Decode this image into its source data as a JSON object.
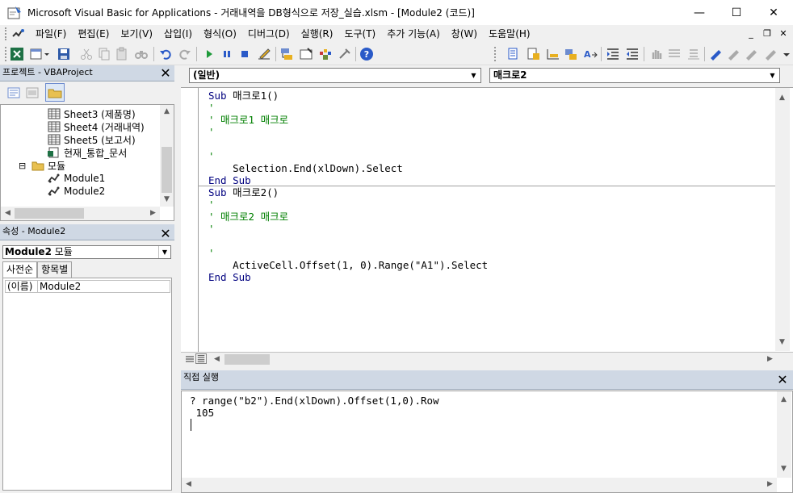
{
  "window": {
    "title": "Microsoft Visual Basic for Applications - 거래내역을 DB형식으로 저장_실습.xlsm - [Module2 (코드)]",
    "minimize": "—",
    "maximize": "☐",
    "close": "✕"
  },
  "menu": {
    "items": [
      "파일(F)",
      "편집(E)",
      "보기(V)",
      "삽입(I)",
      "형식(O)",
      "디버그(D)",
      "실행(R)",
      "도구(T)",
      "추가 기능(A)",
      "창(W)",
      "도움말(H)"
    ],
    "mdi_minimize": "_",
    "mdi_restore": "❐",
    "mdi_close": "✕"
  },
  "toolbar": {
    "icons": [
      "excel-view-icon",
      "insert-module-icon",
      "save-icon",
      "cut-icon",
      "copy-icon",
      "paste-icon",
      "find-icon",
      "undo-icon",
      "redo-icon",
      "run-icon",
      "break-icon",
      "reset-icon",
      "design-mode-icon",
      "project-explorer-icon",
      "properties-icon",
      "object-browser-icon",
      "toolbox-icon",
      "help-icon"
    ],
    "edit_icons": [
      "list-properties-icon",
      "list-constants-icon",
      "quick-info-icon",
      "parameter-info-icon",
      "complete-word-icon",
      "indent-icon",
      "outdent-icon",
      "toggle-breakpoint-icon",
      "comment-block-icon",
      "uncomment-block-icon",
      "toggle-bookmark-icon",
      "next-bookmark-icon",
      "previous-bookmark-icon",
      "clear-bookmarks-icon"
    ]
  },
  "project": {
    "title": "프로젝트 - VBAProject",
    "close": "✕",
    "tree": [
      {
        "label": "Sheet3 (제품명)",
        "icon": "sheet-icon"
      },
      {
        "label": "Sheet4 (거래내역)",
        "icon": "sheet-icon"
      },
      {
        "label": "Sheet5 (보고서)",
        "icon": "sheet-icon"
      },
      {
        "label": "현재_통합_문서",
        "icon": "workbook-icon"
      },
      {
        "label": "모듈",
        "icon": "folder-icon"
      },
      {
        "label": "Module1",
        "icon": "module-icon"
      },
      {
        "label": "Module2",
        "icon": "module-icon"
      }
    ],
    "collapse_toggle": "⊟"
  },
  "properties": {
    "title": "속성 - Module2",
    "close": "✕",
    "object_name": "Module2",
    "object_type": "모듈",
    "tabs": [
      "사전순",
      "항목별"
    ],
    "rows": [
      {
        "key": "(이름)",
        "value": "Module2"
      }
    ]
  },
  "code": {
    "object_combo": "(일반)",
    "procedure_combo": "매크로2",
    "lines": [
      {
        "kw": "Sub ",
        "text": "매크로1()",
        "type": "sub"
      },
      {
        "text": "'",
        "type": "comment"
      },
      {
        "text": "' 매크로1 매크로",
        "type": "comment"
      },
      {
        "text": "'",
        "type": "comment"
      },
      {
        "text": "",
        "type": "blank"
      },
      {
        "text": "'",
        "type": "comment"
      },
      {
        "text": "    Selection.End(xlDown).Select",
        "type": "code"
      },
      {
        "kw": "End Sub",
        "text": "",
        "type": "end"
      },
      {
        "kw": "Sub ",
        "text": "매크로2()",
        "type": "sub"
      },
      {
        "text": "'",
        "type": "comment"
      },
      {
        "text": "' 매크로2 매크로",
        "type": "comment"
      },
      {
        "text": "'",
        "type": "comment"
      },
      {
        "text": "",
        "type": "blank"
      },
      {
        "text": "'",
        "type": "comment"
      },
      {
        "text": "    ActiveCell.Offset(1, 0).Range(\"A1\").Select",
        "type": "code"
      },
      {
        "kw": "End Sub",
        "text": "",
        "type": "end"
      }
    ]
  },
  "immediate": {
    "title": "직접 실행",
    "close": "✕",
    "lines": [
      "? range(\"b2\").End(xlDown).Offset(1,0).Row",
      " 105"
    ]
  },
  "scroll": {
    "up": "▲",
    "down": "▼",
    "left": "◀",
    "right": "▶"
  }
}
